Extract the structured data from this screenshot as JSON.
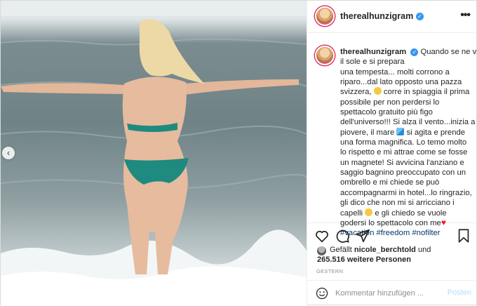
{
  "post": {
    "author": {
      "username": "therealhunzigram",
      "verified_mark": "✓",
      "more_icon": "more-horizontal-icon"
    },
    "photo": {
      "carousel_prev_icon": "‹"
    },
    "caption": {
      "username": "therealhunzigram",
      "lines": [
        "Quando se ne va",
        "il sole e si prepara",
        "una tempesta... molti corrono a",
        "riparo...dal lato opposto una pazza",
        "svizzera,",
        "corre in spiaggia il prima",
        "possibile per non perdersi lo",
        "spettacolo gratuito più figo",
        "dell'universo!!! Si alza il vento...inizia a",
        "piovere, il mare",
        "si agita e prende",
        "una forma magnifica. Lo temo molto",
        "lo rispetto e mi attrae come se fosse",
        "un magnete! Si avvicina l'anziano e",
        "saggio bagnino preoccupato con un",
        "ombrello e mi chiede se può",
        "accompagnarmi in hotel...lo ringrazio,",
        "gli dico che non mi si arricciano i",
        "capelli",
        "e gli chiedo se vuole",
        "godersi lo spettacolo con me"
      ],
      "hashtags": [
        "#vacation",
        "#freedom",
        "#nofilter"
      ]
    },
    "actions": {
      "like_icon": "heart-icon",
      "comment_icon": "comment-icon",
      "share_icon": "share-icon",
      "save_icon": "bookmark-icon"
    },
    "likes": {
      "prefix": "Gefällt",
      "user": "nicole_berchtold",
      "conjunction": "und",
      "others": "265.516 weitere Personen"
    },
    "date": "GESTERN",
    "comment": {
      "placeholder": "Kommentar hinzufügen ...",
      "post_label": "Posten"
    }
  }
}
